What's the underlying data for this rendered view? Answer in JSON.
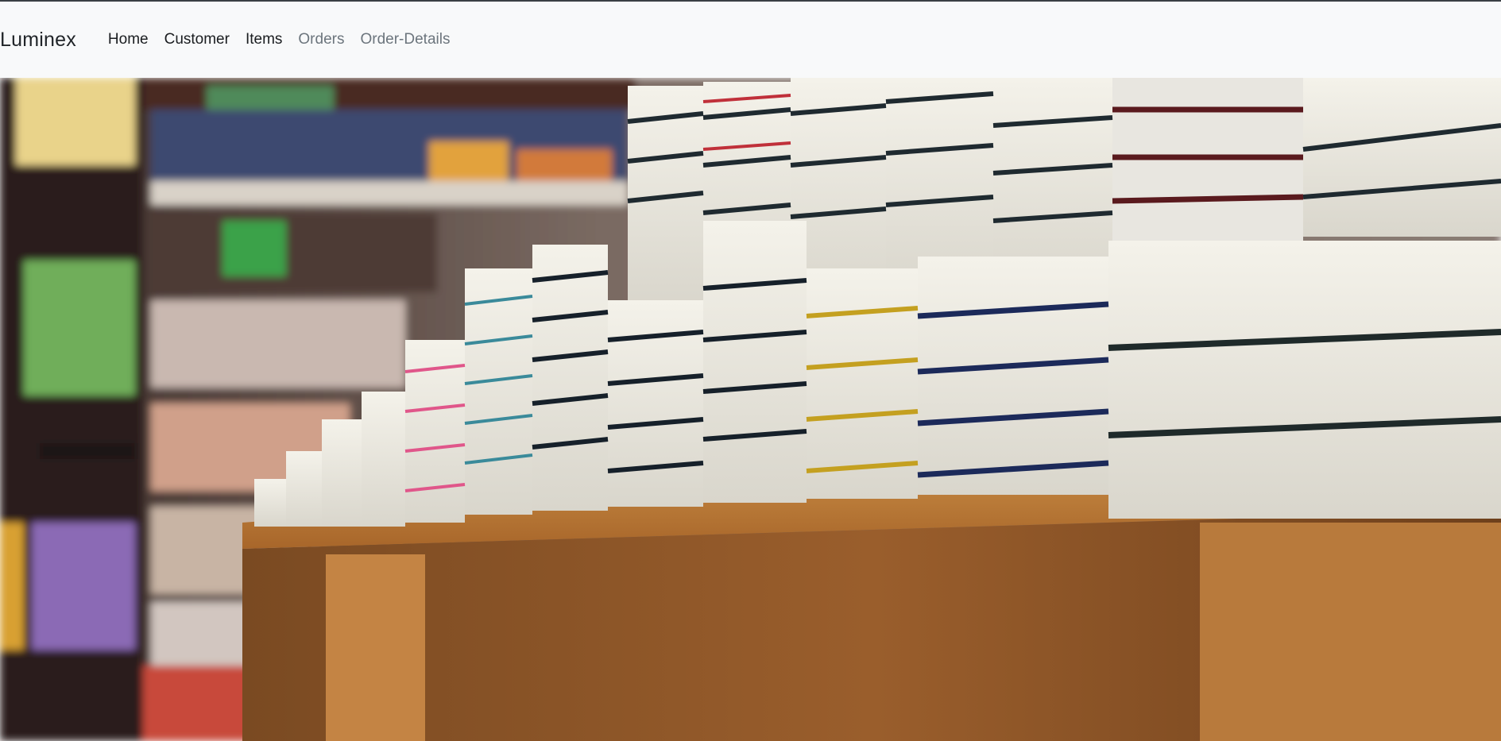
{
  "navbar": {
    "brand": "Luminex",
    "links": [
      {
        "label": "Home",
        "state": "active"
      },
      {
        "label": "Customer",
        "state": "active"
      },
      {
        "label": "Items",
        "state": "active"
      },
      {
        "label": "Orders",
        "state": "muted"
      },
      {
        "label": "Order-Details",
        "state": "muted"
      }
    ]
  },
  "colors": {
    "navbar_bg": "#f8f9fa",
    "link_dark": "#1a1d20",
    "link_muted": "#6c757d",
    "wood": "#b8772f",
    "shelf_dark": "#2a2120"
  }
}
